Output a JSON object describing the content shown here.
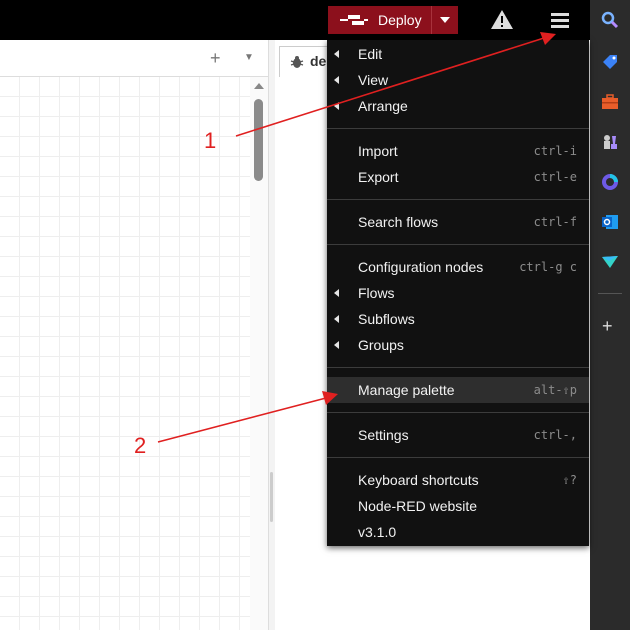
{
  "header": {
    "deploy_label": "Deploy",
    "colors": {
      "header_bg": "#000000",
      "deploy_bg": "#8c101c"
    },
    "icons": [
      "deploy-icon",
      "chevron-down-icon",
      "warning-icon",
      "hamburger-menu-icon"
    ]
  },
  "workspace": {
    "add_tab_icon": "+",
    "tab_list_icon": "▼"
  },
  "sidebar": {
    "tab_label": "de",
    "tab_icon": "bug-icon"
  },
  "rightrail": {
    "icons": [
      "search-icon",
      "tag-icon",
      "briefcase-icon",
      "chess-icon",
      "copilot-icon",
      "outlook-icon",
      "send-icon"
    ],
    "add_label": "+"
  },
  "menu": {
    "items": [
      {
        "label": "Edit",
        "shortcut": "",
        "submenu": true
      },
      {
        "label": "View",
        "shortcut": "",
        "submenu": true
      },
      {
        "label": "Arrange",
        "shortcut": "",
        "submenu": true
      },
      {
        "label": "Import",
        "shortcut": "ctrl-i",
        "submenu": false
      },
      {
        "label": "Export",
        "shortcut": "ctrl-e",
        "submenu": false
      },
      {
        "label": "Search flows",
        "shortcut": "ctrl-f",
        "submenu": false
      },
      {
        "label": "Configuration nodes",
        "shortcut": "ctrl-g c",
        "submenu": false
      },
      {
        "label": "Flows",
        "shortcut": "",
        "submenu": true
      },
      {
        "label": "Subflows",
        "shortcut": "",
        "submenu": true
      },
      {
        "label": "Groups",
        "shortcut": "",
        "submenu": true
      },
      {
        "label": "Manage palette",
        "shortcut": "alt-⇧p",
        "submenu": false,
        "highlighted": true
      },
      {
        "label": "Settings",
        "shortcut": "ctrl-,",
        "submenu": false
      },
      {
        "label": "Keyboard shortcuts",
        "shortcut": "⇧?",
        "submenu": false
      },
      {
        "label": "Node-RED website",
        "shortcut": "",
        "submenu": false
      },
      {
        "label": "v3.1.0",
        "shortcut": "",
        "submenu": false
      }
    ]
  },
  "annotations": {
    "labels": [
      "1",
      "2"
    ],
    "color": "#e02020"
  }
}
